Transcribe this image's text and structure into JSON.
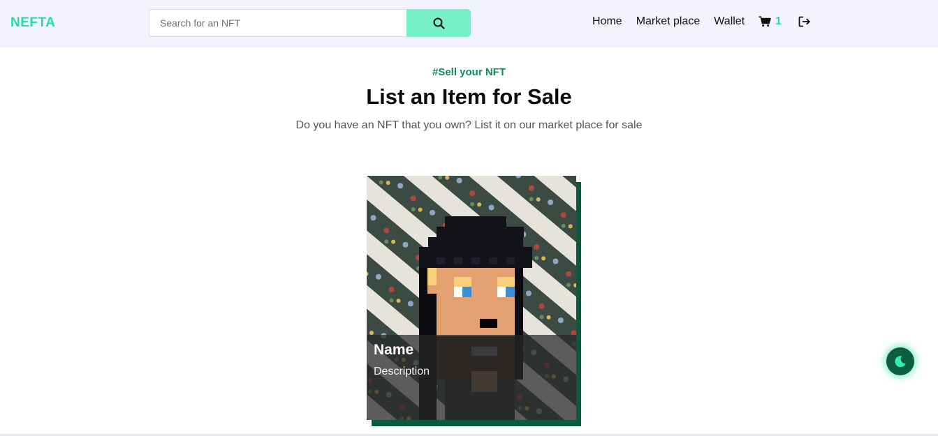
{
  "brand": {
    "name": "NEFTA",
    "color": "#1fe0a0"
  },
  "search": {
    "placeholder": "Search for an NFT",
    "value": "",
    "button_icon": "search-icon"
  },
  "nav": {
    "links": [
      "Home",
      "Market place",
      "Wallet"
    ],
    "cart_icon": "cart-icon",
    "cart_count": "1",
    "logout_icon": "logout-icon"
  },
  "hero": {
    "eyebrow": "#Sell your NFT",
    "title": "List an Item for Sale",
    "subtitle": "Do you have an NFT that you own? List it on our market place for sale"
  },
  "card": {
    "name": "Name",
    "description": "Description",
    "image": "pixel-art-nft-image"
  },
  "theme_toggle": {
    "icon": "moon-icon"
  },
  "colors": {
    "accent": "#1fe0a0",
    "accent_dark": "#0b5a3d",
    "nav_bg": "#f3f3ff",
    "search_button": "#76f0c8"
  }
}
